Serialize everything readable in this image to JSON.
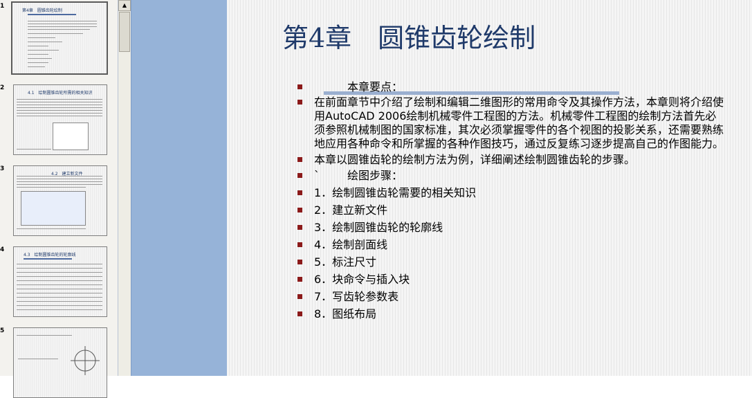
{
  "thumbnails": [
    {
      "number": "1",
      "title": "第4章　圆锥齿轮绘制",
      "selected": true
    },
    {
      "number": "2",
      "title": "4.1　绘制圆锥齿轮所需的相关知识",
      "selected": false
    },
    {
      "number": "3",
      "title": "4.2　建立新文件",
      "selected": false
    },
    {
      "number": "4",
      "title": "4.3　绘制圆锥齿轮的轮廓线",
      "selected": false
    },
    {
      "number": "5",
      "title": "",
      "selected": false
    }
  ],
  "scrollbar": {
    "up_arrow": "▲"
  },
  "slide": {
    "title": "第4章　圆锥齿轮绘制",
    "bullets": {
      "key_points": "本章要点：",
      "intro": "在前面章节中介绍了绘制和编辑二维图形的常用命令及其操作方法，本章则将介绍使用AutoCAD 2006绘制机械零件工程图的方法。机械零件工程图的绘制方法首先必须参照机械制图的国家标准，其次必须掌握零件的各个视图的投影关系，还需要熟练地应用各种命令和所掌握的各种作图技巧，通过反复练习逐步提高自己的作图能力。",
      "example": "本章以圆锥齿轮的绘制方法为例，详细阐述绘制圆锥齿轮的步骤。",
      "steps_mark": "`",
      "steps_label": "绘图步骤：",
      "steps": [
        "1．绘制圆锥齿轮需要的相关知识",
        "2．建立新文件",
        "3．绘制圆锥齿轮的轮廓线",
        "4．绘制剖面线",
        "5．标注尺寸",
        "6．块命令与插入块",
        "7．写齿轮参数表",
        "8．图纸布局"
      ]
    }
  },
  "colors": {
    "title": "#1f3a6a",
    "bullet": "#8b1a1a",
    "gutter": "#96b3d8",
    "rule": "#9aafd0"
  }
}
